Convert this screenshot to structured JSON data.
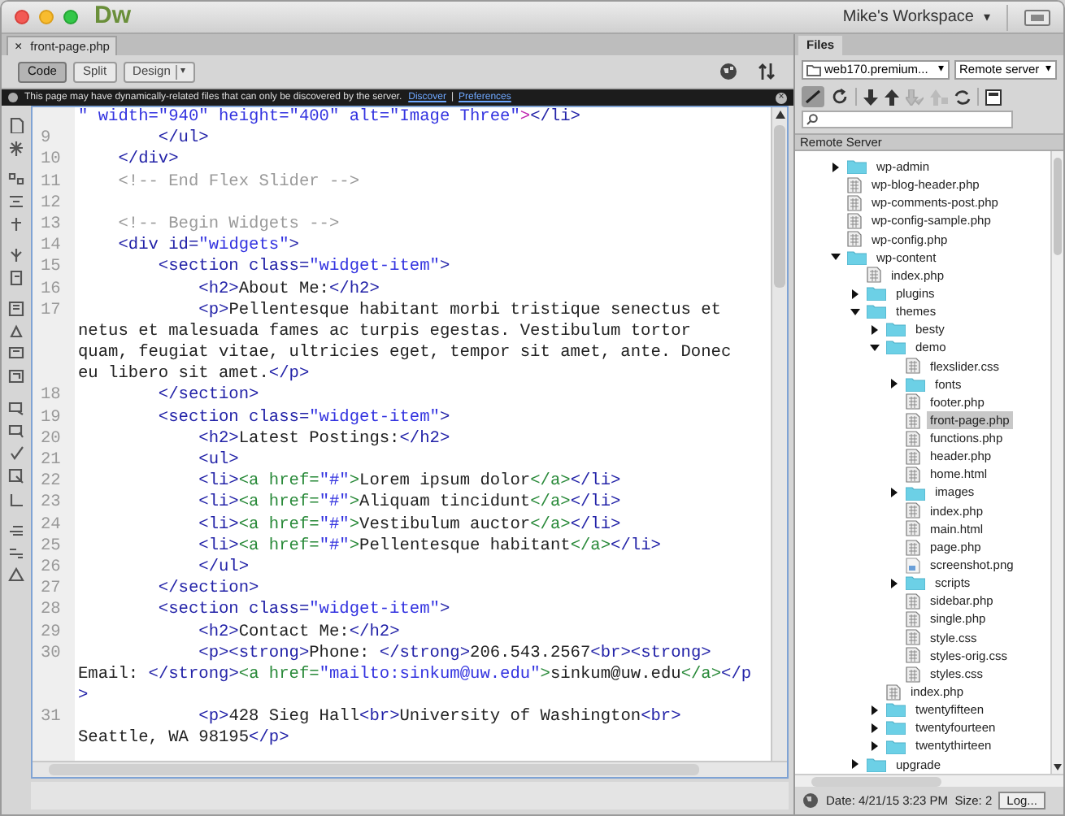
{
  "app": {
    "logo": "Dw",
    "workspace": "Mike's Workspace",
    "workspace_caret": "▾"
  },
  "document_tab": {
    "close": "×",
    "title": "front-page.php"
  },
  "view_buttons": [
    {
      "label": "Code",
      "selected": true
    },
    {
      "label": "Split",
      "selected": false
    },
    {
      "label": "Design",
      "selected": false
    }
  ],
  "design_caret": "▾",
  "info_bar": {
    "message": "This page may have dynamically-related files that can only be discovered by the server.",
    "links": [
      "Discover",
      "Preferences"
    ],
    "separator": "|",
    "close": "×"
  },
  "code_lines": [
    {
      "rows": [
        {
          "tokens": [
            {
              "kind": "value",
              "text": "\" width=\"940\" height=\"400\" alt=\"Image Three\""
            },
            {
              "kind": "mark",
              "text": ">"
            },
            {
              "kind": "tag",
              "text": "</li>"
            }
          ]
        }
      ]
    },
    {
      "number": "9",
      "rows": [
        {
          "tokens": [
            {
              "kind": "tag",
              "text": "        </ul>"
            }
          ]
        }
      ]
    },
    {
      "number": "10",
      "rows": [
        {
          "tokens": [
            {
              "kind": "tag",
              "text": "    </div>"
            }
          ]
        }
      ]
    },
    {
      "number": "11",
      "rows": [
        {
          "tokens": [
            {
              "kind": "comment",
              "text": "    <!-- End Flex Slider -->"
            }
          ]
        }
      ]
    },
    {
      "number": "12"
    },
    {
      "number": "13",
      "rows": [
        {
          "tokens": [
            {
              "kind": "comment",
              "text": "    <!-- Begin Widgets -->"
            }
          ]
        }
      ]
    },
    {
      "number": "14",
      "rows": [
        {
          "tokens": [
            {
              "kind": "tag",
              "text": "    <div id="
            },
            {
              "kind": "value",
              "text": "\"widgets\""
            },
            {
              "kind": "tag",
              "text": ">"
            }
          ]
        }
      ]
    },
    {
      "number": "15",
      "rows": [
        {
          "tokens": [
            {
              "kind": "tag",
              "text": "        <section class="
            },
            {
              "kind": "value",
              "text": "\"widget-item\""
            },
            {
              "kind": "tag",
              "text": ">"
            }
          ]
        }
      ]
    },
    {
      "number": "16",
      "rows": [
        {
          "tokens": [
            {
              "kind": "tag",
              "text": "            <h2>"
            },
            {
              "kind": "text",
              "text": "About Me:"
            },
            {
              "kind": "tag",
              "text": "</h2>"
            }
          ]
        }
      ]
    },
    {
      "number": "17",
      "rows": [
        {
          "tokens": [
            {
              "kind": "tag",
              "text": "            <p>"
            },
            {
              "kind": "text",
              "text": "Pellentesque habitant morbi tristique senectus et"
            }
          ]
        },
        {
          "tokens": [
            {
              "kind": "text",
              "text": "netus et malesuada fames ac turpis egestas. Vestibulum tortor"
            }
          ]
        },
        {
          "tokens": [
            {
              "kind": "text",
              "text": "quam, feugiat vitae, ultricies eget, tempor sit amet, ante. Donec"
            }
          ]
        },
        {
          "tokens": [
            {
              "kind": "text",
              "text": "eu libero sit amet."
            },
            {
              "kind": "tag",
              "text": "</p>"
            }
          ]
        }
      ]
    },
    {
      "number": "18",
      "rows": [
        {
          "tokens": [
            {
              "kind": "tag",
              "text": "        </section>"
            }
          ]
        }
      ]
    },
    {
      "number": "19",
      "rows": [
        {
          "tokens": [
            {
              "kind": "tag",
              "text": "        <section class="
            },
            {
              "kind": "value",
              "text": "\"widget-item\""
            },
            {
              "kind": "tag",
              "text": ">"
            }
          ]
        }
      ]
    },
    {
      "number": "20",
      "rows": [
        {
          "tokens": [
            {
              "kind": "tag",
              "text": "            <h2>"
            },
            {
              "kind": "text",
              "text": "Latest Postings:"
            },
            {
              "kind": "tag",
              "text": "</h2>"
            }
          ]
        }
      ]
    },
    {
      "number": "21",
      "rows": [
        {
          "tokens": [
            {
              "kind": "tag",
              "text": "            <ul>"
            }
          ]
        }
      ]
    },
    {
      "number": "22",
      "rows": [
        {
          "tokens": [
            {
              "kind": "tag",
              "text": "            <li>"
            },
            {
              "kind": "link",
              "text": "<a href="
            },
            {
              "kind": "value",
              "text": "\"#\""
            },
            {
              "kind": "link",
              "text": ">"
            },
            {
              "kind": "text",
              "text": "Lorem ipsum dolor"
            },
            {
              "kind": "link",
              "text": "</a>"
            },
            {
              "kind": "tag",
              "text": "</li>"
            }
          ]
        }
      ]
    },
    {
      "number": "23",
      "rows": [
        {
          "tokens": [
            {
              "kind": "tag",
              "text": "            <li>"
            },
            {
              "kind": "link",
              "text": "<a href="
            },
            {
              "kind": "value",
              "text": "\"#\""
            },
            {
              "kind": "link",
              "text": ">"
            },
            {
              "kind": "text",
              "text": "Aliquam tincidunt"
            },
            {
              "kind": "link",
              "text": "</a>"
            },
            {
              "kind": "tag",
              "text": "</li>"
            }
          ]
        }
      ]
    },
    {
      "number": "24",
      "rows": [
        {
          "tokens": [
            {
              "kind": "tag",
              "text": "            <li>"
            },
            {
              "kind": "link",
              "text": "<a href="
            },
            {
              "kind": "value",
              "text": "\"#\""
            },
            {
              "kind": "link",
              "text": ">"
            },
            {
              "kind": "text",
              "text": "Vestibulum auctor"
            },
            {
              "kind": "link",
              "text": "</a>"
            },
            {
              "kind": "tag",
              "text": "</li>"
            }
          ]
        }
      ]
    },
    {
      "number": "25",
      "rows": [
        {
          "tokens": [
            {
              "kind": "tag",
              "text": "            <li>"
            },
            {
              "kind": "link",
              "text": "<a href="
            },
            {
              "kind": "value",
              "text": "\"#\""
            },
            {
              "kind": "link",
              "text": ">"
            },
            {
              "kind": "text",
              "text": "Pellentesque habitant"
            },
            {
              "kind": "link",
              "text": "</a>"
            },
            {
              "kind": "tag",
              "text": "</li>"
            }
          ]
        }
      ]
    },
    {
      "number": "26",
      "rows": [
        {
          "tokens": [
            {
              "kind": "tag",
              "text": "            </ul>"
            }
          ]
        }
      ]
    },
    {
      "number": "27",
      "rows": [
        {
          "tokens": [
            {
              "kind": "tag",
              "text": "        </section>"
            }
          ]
        }
      ]
    },
    {
      "number": "28",
      "rows": [
        {
          "tokens": [
            {
              "kind": "tag",
              "text": "        <section class="
            },
            {
              "kind": "value",
              "text": "\"widget-item\""
            },
            {
              "kind": "tag",
              "text": ">"
            }
          ]
        }
      ]
    },
    {
      "number": "29",
      "rows": [
        {
          "tokens": [
            {
              "kind": "tag",
              "text": "            <h2>"
            },
            {
              "kind": "text",
              "text": "Contact Me:"
            },
            {
              "kind": "tag",
              "text": "</h2>"
            }
          ]
        }
      ]
    },
    {
      "number": "30",
      "rows": [
        {
          "tokens": [
            {
              "kind": "tag",
              "text": "            <p><strong>"
            },
            {
              "kind": "text",
              "text": "Phone: "
            },
            {
              "kind": "tag",
              "text": "</strong>"
            },
            {
              "kind": "text",
              "text": "206.543.2567"
            },
            {
              "kind": "tag",
              "text": "<br><strong>"
            }
          ]
        },
        {
          "tokens": [
            {
              "kind": "text",
              "text": "Email: "
            },
            {
              "kind": "tag",
              "text": "</strong>"
            },
            {
              "kind": "link",
              "text": "<a href="
            },
            {
              "kind": "value",
              "text": "\"mailto:sinkum@uw.edu\""
            },
            {
              "kind": "link",
              "text": ">"
            },
            {
              "kind": "text",
              "text": "sinkum@uw.edu"
            },
            {
              "kind": "link",
              "text": "</a>"
            },
            {
              "kind": "tag",
              "text": "</p"
            }
          ]
        },
        {
          "tokens": [
            {
              "kind": "tag",
              "text": ">"
            }
          ]
        }
      ]
    },
    {
      "number": "31",
      "rows": [
        {
          "tokens": [
            {
              "kind": "tag",
              "text": "            <p>"
            },
            {
              "kind": "text",
              "text": "428 Sieg Hall"
            },
            {
              "kind": "tag",
              "text": "<br>"
            },
            {
              "kind": "text",
              "text": "University of Washington"
            },
            {
              "kind": "tag",
              "text": "<br>"
            }
          ]
        },
        {
          "tokens": [
            {
              "kind": "text",
              "text": "Seattle, WA 98195"
            },
            {
              "kind": "tag",
              "text": "</p>"
            }
          ]
        }
      ]
    }
  ],
  "files_panel": {
    "tab": "Files",
    "site": "web170.premium...",
    "site_caret": "▾",
    "view": "Remote server",
    "view_caret": "▾",
    "section": "Remote Server",
    "tree": [
      {
        "kind": "folder",
        "name": "wp-admin",
        "expanded": false,
        "selected": false
      },
      {
        "kind": "file",
        "name": "wp-blog-header.php",
        "selected": false
      },
      {
        "kind": "file",
        "name": "wp-comments-post.php",
        "selected": false
      },
      {
        "kind": "file",
        "name": "wp-config-sample.php",
        "selected": false
      },
      {
        "kind": "file",
        "name": "wp-config.php",
        "selected": false
      },
      {
        "kind": "folder",
        "name": "wp-content",
        "expanded": true,
        "selected": false,
        "children": [
          {
            "kind": "file",
            "name": "index.php",
            "selected": false
          },
          {
            "kind": "folder",
            "name": "plugins",
            "expanded": false,
            "selected": false
          },
          {
            "kind": "folder",
            "name": "themes",
            "expanded": true,
            "selected": false,
            "children": [
              {
                "kind": "folder",
                "name": "besty",
                "expanded": false,
                "selected": false
              },
              {
                "kind": "folder",
                "name": "demo",
                "expanded": true,
                "selected": false,
                "children": [
                  {
                    "kind": "file",
                    "name": "flexslider.css",
                    "selected": false
                  },
                  {
                    "kind": "folder",
                    "name": "fonts",
                    "expanded": false,
                    "selected": false
                  },
                  {
                    "kind": "file",
                    "name": "footer.php",
                    "selected": false
                  },
                  {
                    "kind": "file",
                    "name": "front-page.php",
                    "selected": true
                  },
                  {
                    "kind": "file",
                    "name": "functions.php",
                    "selected": false
                  },
                  {
                    "kind": "file",
                    "name": "header.php",
                    "selected": false
                  },
                  {
                    "kind": "file",
                    "name": "home.html",
                    "selected": false
                  },
                  {
                    "kind": "folder",
                    "name": "images",
                    "expanded": false,
                    "selected": false
                  },
                  {
                    "kind": "file",
                    "name": "index.php",
                    "selected": false
                  },
                  {
                    "kind": "file",
                    "name": "main.html",
                    "selected": false
                  },
                  {
                    "kind": "file",
                    "name": "page.php",
                    "selected": false
                  },
                  {
                    "kind": "image",
                    "name": "screenshot.png",
                    "selected": false
                  },
                  {
                    "kind": "folder",
                    "name": "scripts",
                    "expanded": false,
                    "selected": false
                  },
                  {
                    "kind": "file",
                    "name": "sidebar.php",
                    "selected": false
                  },
                  {
                    "kind": "file",
                    "name": "single.php",
                    "selected": false
                  },
                  {
                    "kind": "file",
                    "name": "style.css",
                    "selected": false
                  },
                  {
                    "kind": "file",
                    "name": "styles-orig.css",
                    "selected": false
                  },
                  {
                    "kind": "file",
                    "name": "styles.css",
                    "selected": false
                  }
                ]
              },
              {
                "kind": "file",
                "name": "index.php",
                "selected": false
              },
              {
                "kind": "folder",
                "name": "twentyfifteen",
                "expanded": false,
                "selected": false
              },
              {
                "kind": "folder",
                "name": "twentyfourteen",
                "expanded": false,
                "selected": false
              },
              {
                "kind": "folder",
                "name": "twentythirteen",
                "expanded": false,
                "selected": false
              }
            ]
          },
          {
            "kind": "folder",
            "name": "upgrade",
            "expanded": false,
            "selected": false
          }
        ]
      }
    ],
    "status": "Date: 4/21/15 3:23 PM  Size: 2",
    "log_button": "Log..."
  }
}
